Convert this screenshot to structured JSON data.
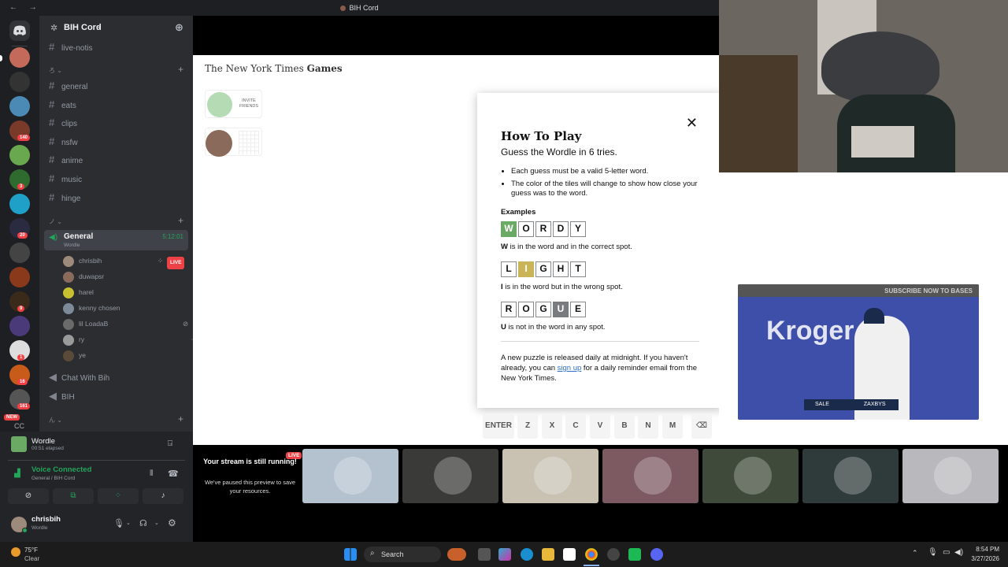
{
  "window": {
    "title": "BIH Cord"
  },
  "servers": {
    "badges": [
      "140",
      "3",
      "20",
      "9",
      "1",
      "16",
      "161"
    ],
    "new_label": "NEW",
    "small_label": "CC"
  },
  "sidebar": {
    "server_name": "BIH Cord",
    "top_channel": "live-notis",
    "category1": "ろ",
    "text_channels": [
      "general",
      "eats",
      "clips",
      "nsfw",
      "anime",
      "music",
      "hinge"
    ],
    "category2": "ノ",
    "voice": {
      "name": "General",
      "timer": "5:12:01",
      "activity": "Wordle"
    },
    "voice_users": [
      {
        "name": "chrisbih",
        "color": "#9e8a7a"
      },
      {
        "name": "duwapsr",
        "color": "#8a6a5a"
      },
      {
        "name": "harel",
        "color": "#c8c030"
      },
      {
        "name": "kenny chosen",
        "color": "#7d8a9a"
      },
      {
        "name": "lil LoadaB",
        "color": "#6a6a6a"
      },
      {
        "name": "ry",
        "color": "#9a9a9a"
      },
      {
        "name": "ye",
        "color": "#5a4a3a"
      }
    ],
    "live_label": "LIVE",
    "other_channels": [
      "Chat With Bih",
      "BIH"
    ],
    "category3": "ん"
  },
  "bottom": {
    "activity_name": "Wordle",
    "activity_elapsed": "00:51 elapsed",
    "voice_status": "Voice Connected",
    "voice_location": "General / BIH Cord",
    "user_name": "chrisbih",
    "user_status": "Wordle"
  },
  "nyt": {
    "logo": "The New York Times",
    "logo_games": "Games",
    "invite_label": "INVITE FRIENDS"
  },
  "dialog": {
    "title": "How To Play",
    "subtitle": "Guess the Wordle in 6 tries.",
    "rules": [
      "Each guess must be a valid 5-letter word.",
      "The color of the tiles will change to show how close your guess was to the word."
    ],
    "examples_label": "Examples",
    "example1": {
      "letters": [
        "W",
        "O",
        "R",
        "D",
        "Y"
      ],
      "highlight": 0,
      "state": "correct",
      "letter": "W",
      "text": " is in the word and in the correct spot."
    },
    "example2": {
      "letters": [
        "L",
        "I",
        "G",
        "H",
        "T"
      ],
      "highlight": 1,
      "state": "present",
      "letter": "I",
      "text": " is in the word but in the wrong spot."
    },
    "example3": {
      "letters": [
        "R",
        "O",
        "G",
        "U",
        "E"
      ],
      "highlight": 3,
      "state": "absent",
      "letter": "U",
      "text": " is not in the word in any spot."
    },
    "footer_a": "A new puzzle is released daily at midnight. If you haven't already, you can ",
    "footer_link": "sign up",
    "footer_b": " for a daily reminder email from the New York Times."
  },
  "keyboard": [
    "ENTER",
    "Z",
    "X",
    "C",
    "V",
    "B",
    "N",
    "M",
    "⌫"
  ],
  "video": {
    "overlay": "SUBSCRIBE NOW TO BASES",
    "brand": "Kroger",
    "scoreboard_name": "SALE",
    "scoreboard_team": "ZAXBYS"
  },
  "stream": {
    "paused_title": "Your stream is still running!",
    "paused_body": "We've paused this preview to save your resources.",
    "live_label": "LIVE",
    "thumbs": [
      "#b4c2cf",
      "#3a3a38",
      "#c9c2b3",
      "#7d5a62",
      "#3f4a3a",
      "#2f3a3a",
      "#b8b8bd"
    ]
  },
  "taskbar": {
    "weather_temp": "75°F",
    "weather_cond": "Clear",
    "search": "Search",
    "time": "8:54 PM",
    "date": "3/27/2026"
  }
}
